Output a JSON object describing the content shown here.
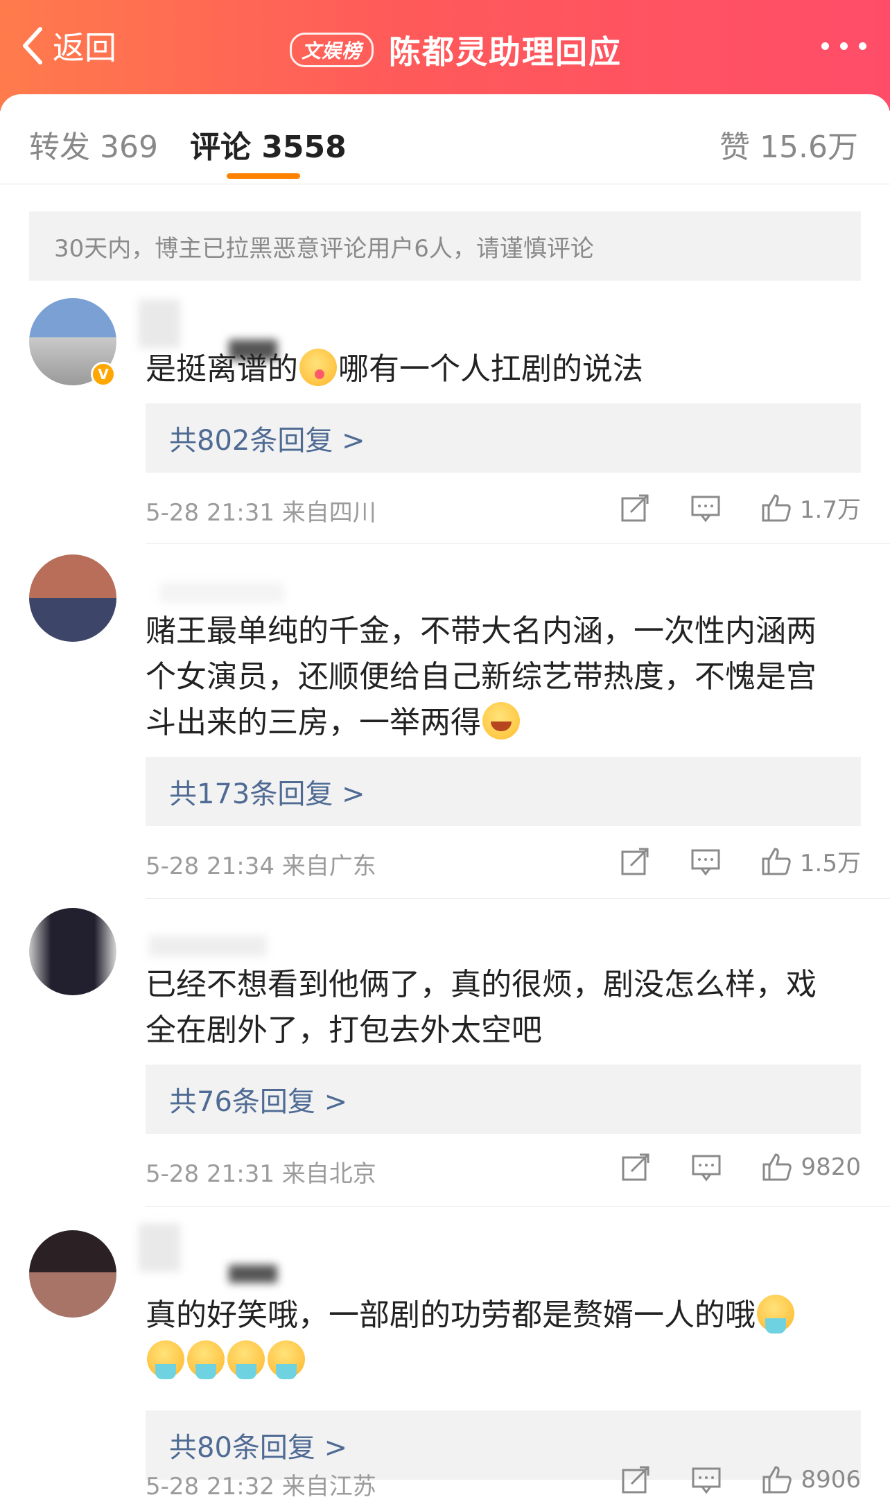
{
  "header": {
    "back_label": "返回",
    "badge": "文娱榜",
    "title": "陈都灵助理回应"
  },
  "tabs": {
    "repost": "转发 369",
    "comments": "评论 3558",
    "likes": "赞 15.6万"
  },
  "notice": "30天内，博主已拉黑恶意评论用户6人，请谨慎评论",
  "comments": [
    {
      "text": "是挺离谱的",
      "text_after": "哪有一个人扛剧的说法",
      "emoji": "yum-face-icon",
      "replies": "共802条回复 >",
      "time": "5-28 21:31",
      "location": "来自四川",
      "likes": "1.7万"
    },
    {
      "text": "赌王最单纯的千金，不带大名内涵，一次性内涵两个女演员，还顺便给自己新综艺带热度，不愧是宫斗出来的三房，一举两得",
      "emoji": "laugh-cry-icon",
      "replies": "共173条回复 >",
      "time": "5-28 21:34",
      "location": "来自广东",
      "likes": "1.5万"
    },
    {
      "text": "已经不想看到他俩了，真的很烦，剧没怎么样，戏全在剧外了，打包去外太空吧",
      "replies": "共76条回复 >",
      "time": "5-28 21:31",
      "location": "来自北京",
      "likes": "9820"
    },
    {
      "text": "真的好笑哦，一部剧的功劳都是赘婿一人的哦",
      "emoji": "vomit-face-icon",
      "replies": "共80条回复 >",
      "time": "5-28 21:32",
      "location": "来自江苏",
      "likes": "8906"
    }
  ],
  "colors": {
    "header_start": "#ff7b4c",
    "header_end": "#ff4d68",
    "tab_underline": "#ff8200",
    "reply_link": "#4f6b94"
  }
}
